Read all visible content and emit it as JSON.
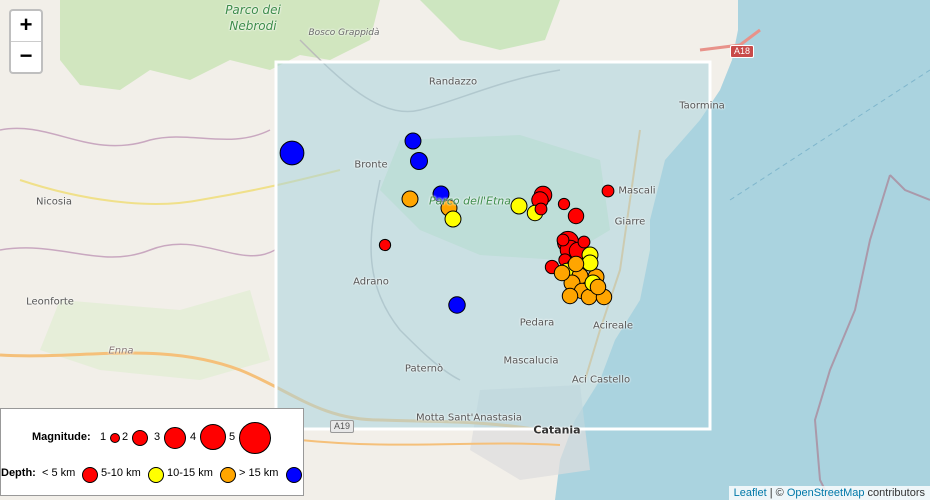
{
  "zoom": {
    "in_label": "+",
    "out_label": "−"
  },
  "places": {
    "parco_nebrodi_1": "Parco dei",
    "parco_nebrodi_2": "Nebrodi",
    "bosco_grappida": "Bosco Grappidà",
    "randazzo": "Randazzo",
    "taormina": "Taormina",
    "bronte": "Bronte",
    "parco_etna": "Parco dell'Etna",
    "mascali": "Mascali",
    "giarre": "Giarre",
    "nicosia": "Nicosia",
    "leonforte": "Leonforte",
    "enna": "Enna",
    "adrano": "Adrano",
    "pedara": "Pedara",
    "acireale": "Acireale",
    "mascalucia": "Mascalucia",
    "paterno": "Paternò",
    "aci_castello": "Aci Castello",
    "motta": "Motta Sant'Anastasia",
    "catania": "Catania"
  },
  "roads": {
    "a18": "A18",
    "a19": "A19"
  },
  "legend": {
    "magnitude_label": "Magnitude:",
    "mag_values": [
      "1",
      "2",
      "3",
      "4",
      "5"
    ],
    "depth_label": "Depth:",
    "depth_classes": [
      {
        "label": "< 5 km",
        "color": "#ff0000"
      },
      {
        "label": "5-10 km",
        "color": "#ffff00"
      },
      {
        "label": "10-15 km",
        "color": "#ffa500"
      },
      {
        "label": "> 15 km",
        "color": "#0000ff"
      }
    ]
  },
  "attribution": {
    "leaflet": "Leaflet",
    "sep": " | © ",
    "osm": "OpenStreetMap",
    "suffix": " contributors"
  },
  "colors": {
    "shallow": "#ff0000",
    "mid": "#ffff00",
    "deep": "#ffa500",
    "deepest": "#0000ff",
    "selection": "#aad3df"
  },
  "earthquakes": [
    {
      "depth_class": "deepest",
      "magnitude": 3.8
    },
    {
      "depth_class": "deepest",
      "magnitude": 2.3
    },
    {
      "depth_class": "deepest",
      "magnitude": 2.5
    },
    {
      "depth_class": "deepest",
      "magnitude": 2.3
    },
    {
      "depth_class": "deepest",
      "magnitude": 2.4
    },
    {
      "depth_class": "deep",
      "magnitude": 2.3
    },
    {
      "depth_class": "deep",
      "magnitude": 2.3
    },
    {
      "depth_class": "mid",
      "magnitude": 2.3
    },
    {
      "depth_class": "mid",
      "magnitude": 2.3
    },
    {
      "depth_class": "shallow",
      "magnitude": 1.4
    },
    {
      "depth_class": "shallow",
      "magnitude": 2.6
    },
    {
      "depth_class": "shallow",
      "magnitude": 2.4
    },
    {
      "depth_class": "mid",
      "magnitude": 2.2
    },
    {
      "depth_class": "shallow",
      "magnitude": 1.5
    },
    {
      "depth_class": "shallow",
      "magnitude": 1.4
    },
    {
      "depth_class": "shallow",
      "magnitude": 1.5
    },
    {
      "depth_class": "shallow",
      "magnitude": 2.2
    },
    {
      "depth_class": "shallow",
      "magnitude": 3.3
    },
    {
      "depth_class": "shallow",
      "magnitude": 3.0
    },
    {
      "depth_class": "shallow",
      "magnitude": 2.6
    },
    {
      "depth_class": "shallow",
      "magnitude": 1.5
    },
    {
      "depth_class": "shallow",
      "magnitude": 1.8
    },
    {
      "depth_class": "shallow",
      "magnitude": 1.6
    },
    {
      "depth_class": "mid",
      "magnitude": 2.3
    },
    {
      "depth_class": "mid",
      "magnitude": 2.3
    },
    {
      "depth_class": "mid",
      "magnitude": 2.2
    },
    {
      "depth_class": "mid",
      "magnitude": 2.2
    },
    {
      "depth_class": "deep",
      "magnitude": 2.3
    },
    {
      "depth_class": "deep",
      "magnitude": 2.3
    },
    {
      "depth_class": "deep",
      "magnitude": 2.3
    },
    {
      "depth_class": "deep",
      "magnitude": 2.2
    },
    {
      "depth_class": "deep",
      "magnitude": 2.2
    },
    {
      "depth_class": "deep",
      "magnitude": 2.2
    },
    {
      "depth_class": "deep",
      "magnitude": 2.2
    },
    {
      "depth_class": "mid",
      "magnitude": 2.3
    },
    {
      "depth_class": "mid",
      "magnitude": 2.3
    },
    {
      "depth_class": "deep",
      "magnitude": 2.2
    },
    {
      "depth_class": "deep",
      "magnitude": 2.2
    },
    {
      "depth_class": "deep",
      "magnitude": 2.2
    },
    {
      "depth_class": "shallow",
      "magnitude": 1.5
    }
  ]
}
